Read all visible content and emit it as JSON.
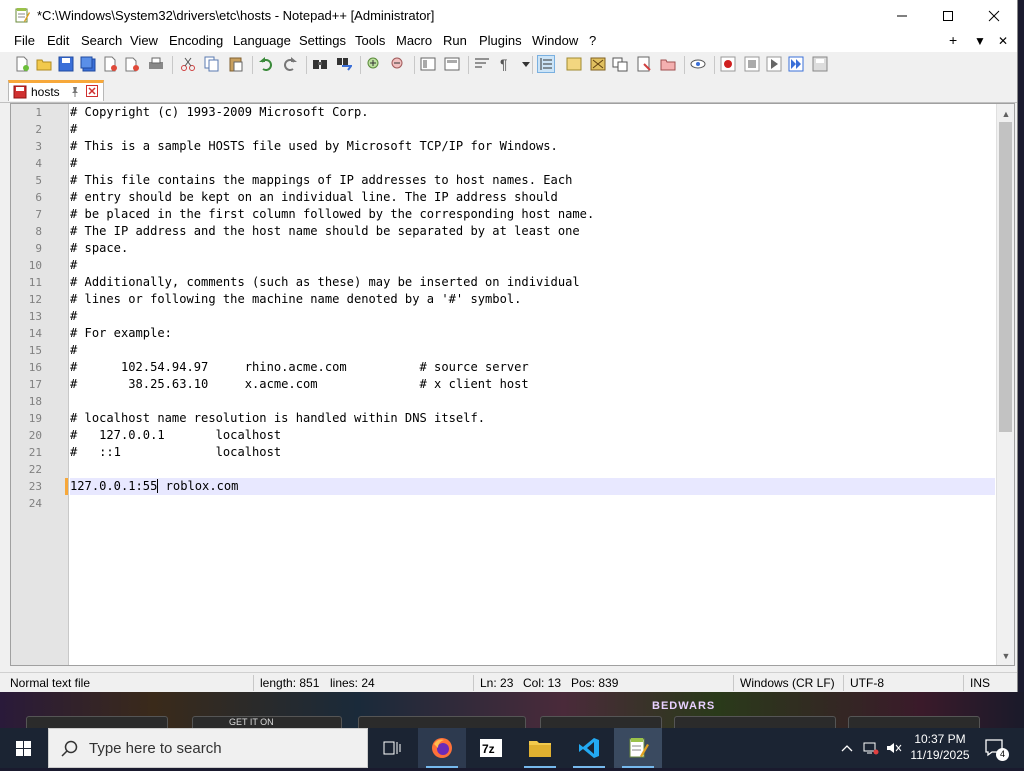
{
  "window": {
    "title": "*C:\\Windows\\System32\\drivers\\etc\\hosts - Notepad++ [Administrator]",
    "minimize_glyph": "—",
    "maximize_glyph": "☐",
    "close_glyph": "✕"
  },
  "menu": {
    "items": [
      "File",
      "Edit",
      "Search",
      "View",
      "Encoding",
      "Language",
      "Settings",
      "Tools",
      "Macro",
      "Run",
      "Plugins",
      "Window",
      "?"
    ],
    "right": [
      "+",
      "▼",
      "✕"
    ]
  },
  "toolbar": {
    "icons": [
      "new-file-icon",
      "open-file-icon",
      "save-icon",
      "save-all-icon",
      "close-icon",
      "close-all-icon",
      "print-icon",
      "cut-icon",
      "copy-icon",
      "paste-icon",
      "undo-icon",
      "redo-icon",
      "find-icon",
      "replace-icon",
      "zoom-in-icon",
      "zoom-out-icon",
      "sync-vertical-icon",
      "sync-horizontal-icon",
      "word-wrap-icon",
      "show-all-chars-icon",
      "indent-guide-icon",
      "doc-map-icon",
      "function-list-icon",
      "folder-workspace-icon",
      "monitoring-icon",
      "record-macro-icon",
      "stop-macro-icon",
      "play-macro-icon",
      "run-macro-multiple-icon",
      "save-macro-icon"
    ]
  },
  "tab": {
    "label": "hosts",
    "pin_glyph": "📌"
  },
  "editor": {
    "lines": [
      "# Copyright (c) 1993-2009 Microsoft Corp.",
      "#",
      "# This is a sample HOSTS file used by Microsoft TCP/IP for Windows.",
      "#",
      "# This file contains the mappings of IP addresses to host names. Each",
      "# entry should be kept on an individual line. The IP address should",
      "# be placed in the first column followed by the corresponding host name.",
      "# The IP address and the host name should be separated by at least one",
      "# space.",
      "#",
      "# Additionally, comments (such as these) may be inserted on individual",
      "# lines or following the machine name denoted by a '#' symbol.",
      "#",
      "# For example:",
      "#",
      "#      102.54.94.97     rhino.acme.com          # source server",
      "#       38.25.63.10     x.acme.com              # x client host",
      "",
      "# localhost name resolution is handled within DNS itself.",
      "#   127.0.0.1       localhost",
      "#   ::1             localhost",
      "",
      "127.0.0.1:55 roblox.com",
      ""
    ],
    "line_numbers": [
      "1",
      "2",
      "3",
      "4",
      "5",
      "6",
      "7",
      "8",
      "9",
      "10",
      "11",
      "12",
      "13",
      "14",
      "15",
      "16",
      "17",
      "18",
      "19",
      "20",
      "21",
      "22",
      "23",
      "24"
    ],
    "current_line": 23,
    "current_before_caret": "127.0.0.1:55",
    "current_after_caret": " roblox.com"
  },
  "statusbar": {
    "file_type": "Normal text file",
    "length": "length: 851",
    "lines": "lines: 24",
    "ln": "Ln: 23",
    "col": "Col: 13",
    "pos": "Pos: 839",
    "eol": "Windows (CR LF)",
    "encoding": "UTF-8",
    "mode": "INS"
  },
  "background_strip": {
    "thumb_text": "GET IT ON",
    "banner_text": "BEDWARS"
  },
  "taskbar": {
    "search_placeholder": "Type here to search",
    "apps": [
      "task-view-icon",
      "firefox-icon",
      "7zip-icon",
      "file-explorer-icon",
      "vscode-icon",
      "notepadpp-icon"
    ],
    "time": "10:37 PM",
    "date": "11/19/2025",
    "notification_count": "4"
  },
  "colors": {
    "tab_accent": "#f7a83a",
    "current_line_bg": "#e8e8ff",
    "taskbar_bg": "#1b2433"
  }
}
